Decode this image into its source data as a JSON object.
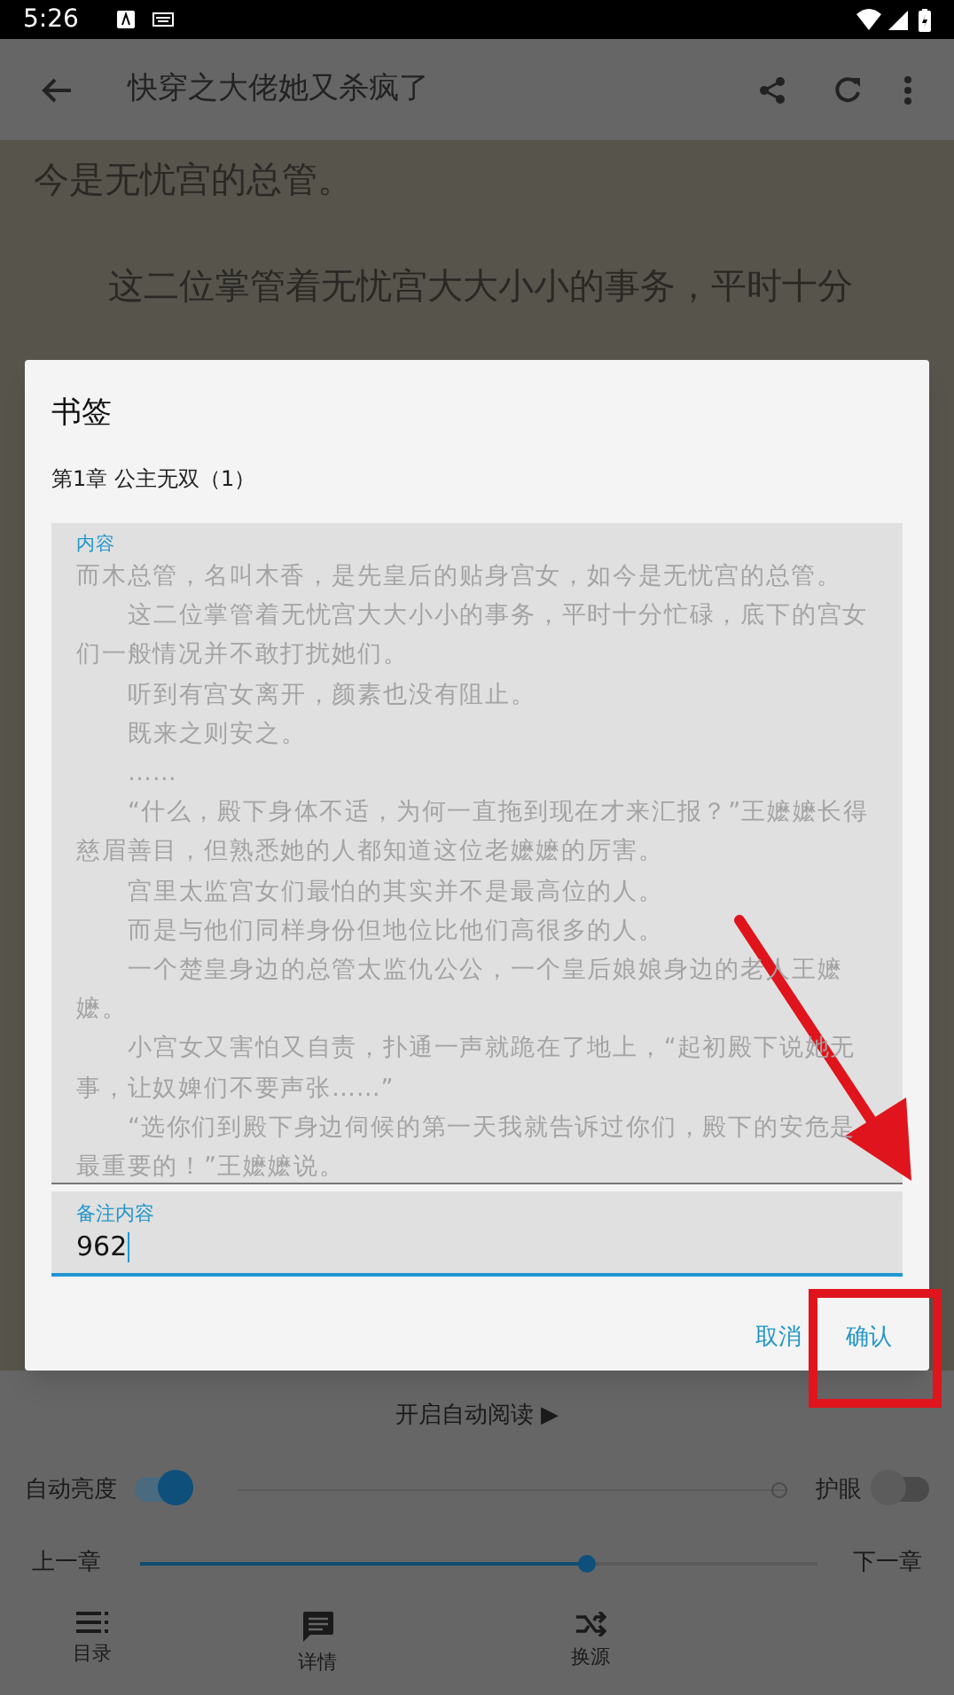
{
  "status_bar": {
    "time": "5:26"
  },
  "toolbar": {
    "title": "快穿之大佬她又杀疯了"
  },
  "reader_lines": [
    {
      "text": "今是无忧宫的总管。",
      "indent": false
    },
    {
      "text": "这二位掌管着无忧宫大大小小的事务，平时十分",
      "indent": true
    }
  ],
  "dialog": {
    "title": "书签",
    "chapter": "第1章 公主无双（1）",
    "content_label": "内容",
    "content": [
      {
        "text": "而木总管，名叫木香，是先皇后的贴身宫女，如今是无忧宫的总管。",
        "indent": false
      },
      {
        "text": "这二位掌管着无忧宫大大小小的事务，平时十分忙碌，底下的宫女们一般情况并不敢打扰她们。",
        "indent": true
      },
      {
        "text": "听到有宫女离开，颜素也没有阻止。",
        "indent": true
      },
      {
        "text": "既来之则安之。",
        "indent": true
      },
      {
        "text": "……",
        "indent": true
      },
      {
        "text": "“什么，殿下身体不适，为何一直拖到现在才来汇报？”王嬷嬷长得慈眉善目，但熟悉她的人都知道这位老嬷嬷的厉害。",
        "indent": true
      },
      {
        "text": "宫里太监宫女们最怕的其实并不是最高位的人。",
        "indent": true
      },
      {
        "text": "而是与他们同样身份但地位比他们高很多的人。",
        "indent": true
      },
      {
        "text": "一个楚皇身边的总管太监仇公公，一个皇后娘娘身边的老人王嬷嬷。",
        "indent": true
      },
      {
        "text": "小宫女又害怕又自责，扑通一声就跪在了地上，“起初殿下说她无事，让奴婢们不要声张……”",
        "indent": true
      },
      {
        "text": "“选你们到殿下身边伺候的第一天我就告诉过你们，殿下的安危是最重要的！”王嬷嬷说。",
        "indent": true
      }
    ],
    "note_label": "备注内容",
    "note_value": "962",
    "buttons": [
      "取消",
      "确认"
    ]
  },
  "controls": {
    "auto_read": "开启自动阅读 ▶",
    "auto_brightness": {
      "label": "自动亮度",
      "on": true
    },
    "brightness": {
      "level": 1.0
    },
    "eye_care": {
      "label": "护眼",
      "on": false
    },
    "prev": "上一章",
    "next": "下一章",
    "chapter_progress": {
      "level": 0.66
    }
  },
  "bottom_nav": [
    {
      "kind": "list",
      "label": "目录"
    },
    {
      "kind": "chat",
      "label": "详情"
    },
    {
      "kind": "shuffle",
      "label": "换源"
    }
  ]
}
